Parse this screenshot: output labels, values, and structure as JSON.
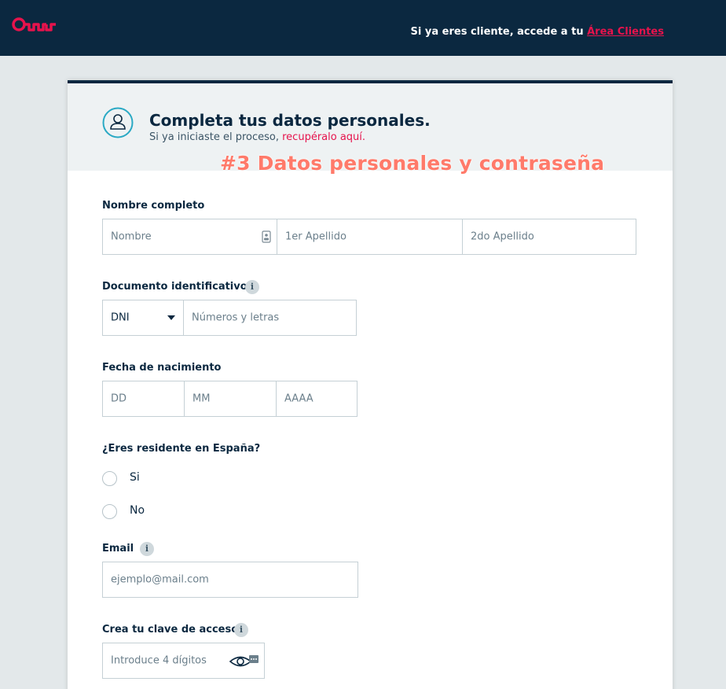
{
  "header": {
    "prompt_text": "Si ya eres cliente, accede a tu ",
    "link_text": "Área Clientes"
  },
  "card": {
    "title": "Completa tus datos personales.",
    "subtitle_text": "Si ya iniciaste el proceso, ",
    "subtitle_link": "recupéralo aquí."
  },
  "overlay_text": "#3 Datos personales y contraseña",
  "form": {
    "full_name": {
      "label": "Nombre completo",
      "name_placeholder": "Nombre",
      "surname1_placeholder": "1er Apellido",
      "surname2_placeholder": "2do Apellido"
    },
    "document": {
      "label": "Documento identificativo",
      "type_value": "DNI",
      "number_placeholder": "Números y letras"
    },
    "birthdate": {
      "label": "Fecha de nacimiento",
      "day_placeholder": "DD",
      "month_placeholder": "MM",
      "year_placeholder": "AAAA"
    },
    "residence": {
      "label": "¿Eres residente en España?",
      "options": [
        "Si",
        "No"
      ]
    },
    "email": {
      "label": "Email",
      "placeholder": "ejemplo@mail.com"
    },
    "password": {
      "label": "Crea tu clave de acceso",
      "placeholder": "Introduce 4 dígitos"
    }
  },
  "colors": {
    "navy": "#0b2840",
    "accent": "#e6134c",
    "overlay": "#ff7a6a"
  },
  "icons": [
    "logo-icon",
    "user-icon",
    "contact-card-icon",
    "info-icon",
    "chevron-down-icon",
    "eye-icon"
  ]
}
